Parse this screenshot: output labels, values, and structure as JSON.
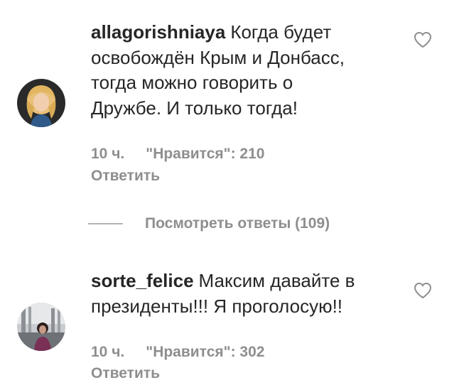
{
  "comments": [
    {
      "username": "allagorishniaya",
      "lines": [
        "Когда будет",
        "освобождён Крым и Донбасс,",
        "тогда можно говорить о",
        "Дружбе. И только тогда!"
      ],
      "time": "10 ч.",
      "likes": "\"Нравится\": 210",
      "reply": "Ответить",
      "avatar_icon": "user-avatar-photo",
      "like_icon": "heart-outline-icon"
    },
    {
      "username": "sorte_felice",
      "lines": [
        "Максим давайте в",
        "президенты!!! Я проголосую!!"
      ],
      "time": "10 ч.",
      "likes": "\"Нравится\": 302",
      "reply": "Ответить",
      "avatar_icon": "user-avatar-photo",
      "like_icon": "heart-outline-icon"
    }
  ],
  "view_replies": {
    "label": "Посмотреть ответы (109)"
  },
  "colors": {
    "text": "#262626",
    "secondary": "#8e8e8e",
    "divider": "#b3b3b3",
    "background": "#ffffff"
  }
}
